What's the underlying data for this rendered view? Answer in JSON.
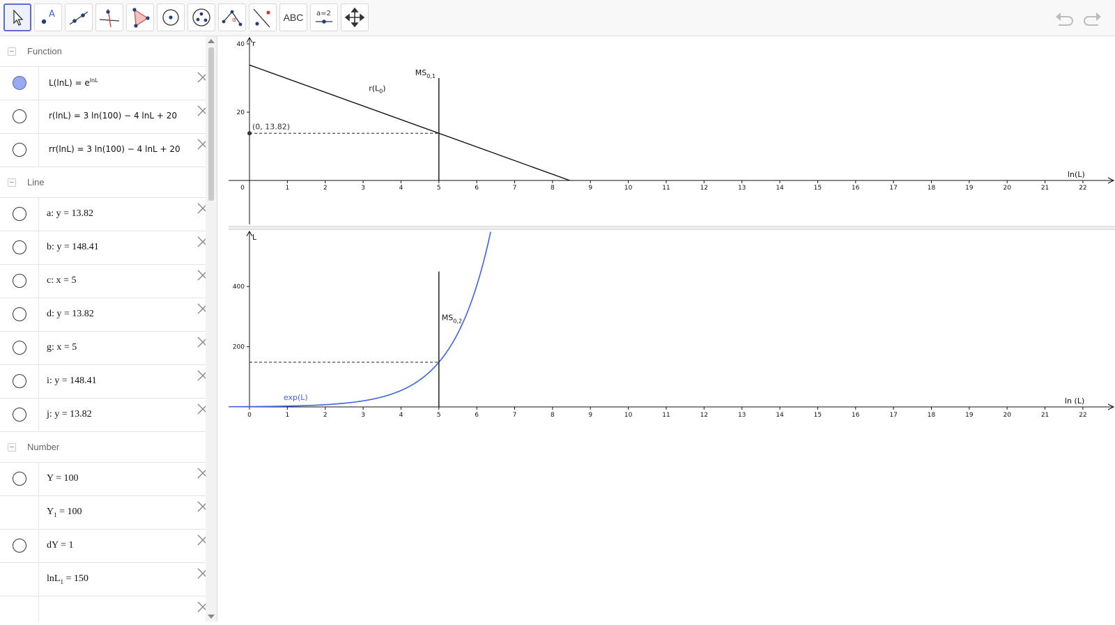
{
  "toolbar": {
    "tools": [
      {
        "name": "move-tool",
        "icon": "cursor-icon"
      },
      {
        "name": "point-tool",
        "icon": "point-icon",
        "label": "A"
      },
      {
        "name": "line-tool",
        "icon": "line-icon"
      },
      {
        "name": "perpendicular-tool",
        "icon": "perpendicular-icon"
      },
      {
        "name": "polygon-tool",
        "icon": "polygon-icon"
      },
      {
        "name": "circle-tool",
        "icon": "circle-icon"
      },
      {
        "name": "ellipse-tool",
        "icon": "ellipse-icon"
      },
      {
        "name": "angle-tool",
        "icon": "angle-icon",
        "label": "α"
      },
      {
        "name": "reflect-tool",
        "icon": "reflect-icon"
      },
      {
        "name": "text-tool",
        "icon": "text-icon",
        "label": "ABC"
      },
      {
        "name": "slider-tool",
        "icon": "slider-icon",
        "label": "a=2"
      },
      {
        "name": "move-graphics-tool",
        "icon": "move-arrows-icon"
      }
    ]
  },
  "algebra": {
    "groups": {
      "function": "Function",
      "line": "Line",
      "number": "Number"
    },
    "functions": [
      {
        "base": "L(lnL) = e",
        "sup": "lnL",
        "visible": true
      },
      {
        "text": "r(lnL) = 3 ln(100) − 4 lnL + 20",
        "visible": false
      },
      {
        "text": "rr(lnL) = 3 ln(100) − 4 lnL + 20",
        "visible": false
      }
    ],
    "lines": [
      {
        "text": "a: y = 13.82"
      },
      {
        "text": "b: y = 148.41"
      },
      {
        "text": "c: x = 5"
      },
      {
        "text": "d: y = 13.82"
      },
      {
        "text": "g: x = 5"
      },
      {
        "text": "i: y = 148.41"
      },
      {
        "text": "j: y = 13.82"
      }
    ],
    "numbers": [
      {
        "text": "Y = 100",
        "marble": true
      },
      {
        "base": "Y",
        "sub": "1",
        "rest": " = 100",
        "marble": false
      },
      {
        "text": "dY = 1",
        "marble": true
      },
      {
        "base": "lnL",
        "sub": "1",
        "rest": " = 150",
        "marble": false
      }
    ]
  },
  "graph_top": {
    "x_label": "ln(L)",
    "y_label": "r",
    "x_ticks": [
      0,
      1,
      2,
      3,
      4,
      5,
      6,
      7,
      8,
      9,
      10,
      11,
      12,
      13,
      14,
      15,
      16,
      17,
      18,
      19,
      20,
      21,
      22
    ],
    "y_ticks": [
      20,
      40
    ],
    "line_label": "r(L",
    "line_label_sub": "0",
    "line_label_end": ")",
    "ms_label": "MS",
    "ms_sub": "0,1",
    "point_label": "(0, 13.82)",
    "line_start": {
      "x": 0,
      "y": 33.82
    },
    "line_end": {
      "x": 8.455,
      "y": 0
    },
    "ms_x": 5,
    "point": {
      "x": 0,
      "y": 13.82
    }
  },
  "graph_bottom": {
    "x_label": "ln (L)",
    "y_label": "L",
    "x_ticks": [
      0,
      1,
      2,
      3,
      4,
      5,
      6,
      7,
      8,
      9,
      10,
      11,
      12,
      13,
      14,
      15,
      16,
      17,
      18,
      19,
      20,
      21,
      22
    ],
    "y_ticks": [
      200,
      400
    ],
    "curve_label": "exp(L)",
    "ms_label": "MS",
    "ms_sub": "0,2",
    "ms_x": 5,
    "ms_top": 450,
    "h_line_y": 148.41
  },
  "colors": {
    "curve": "#3c64e0",
    "accent": "#5d6dc9"
  }
}
